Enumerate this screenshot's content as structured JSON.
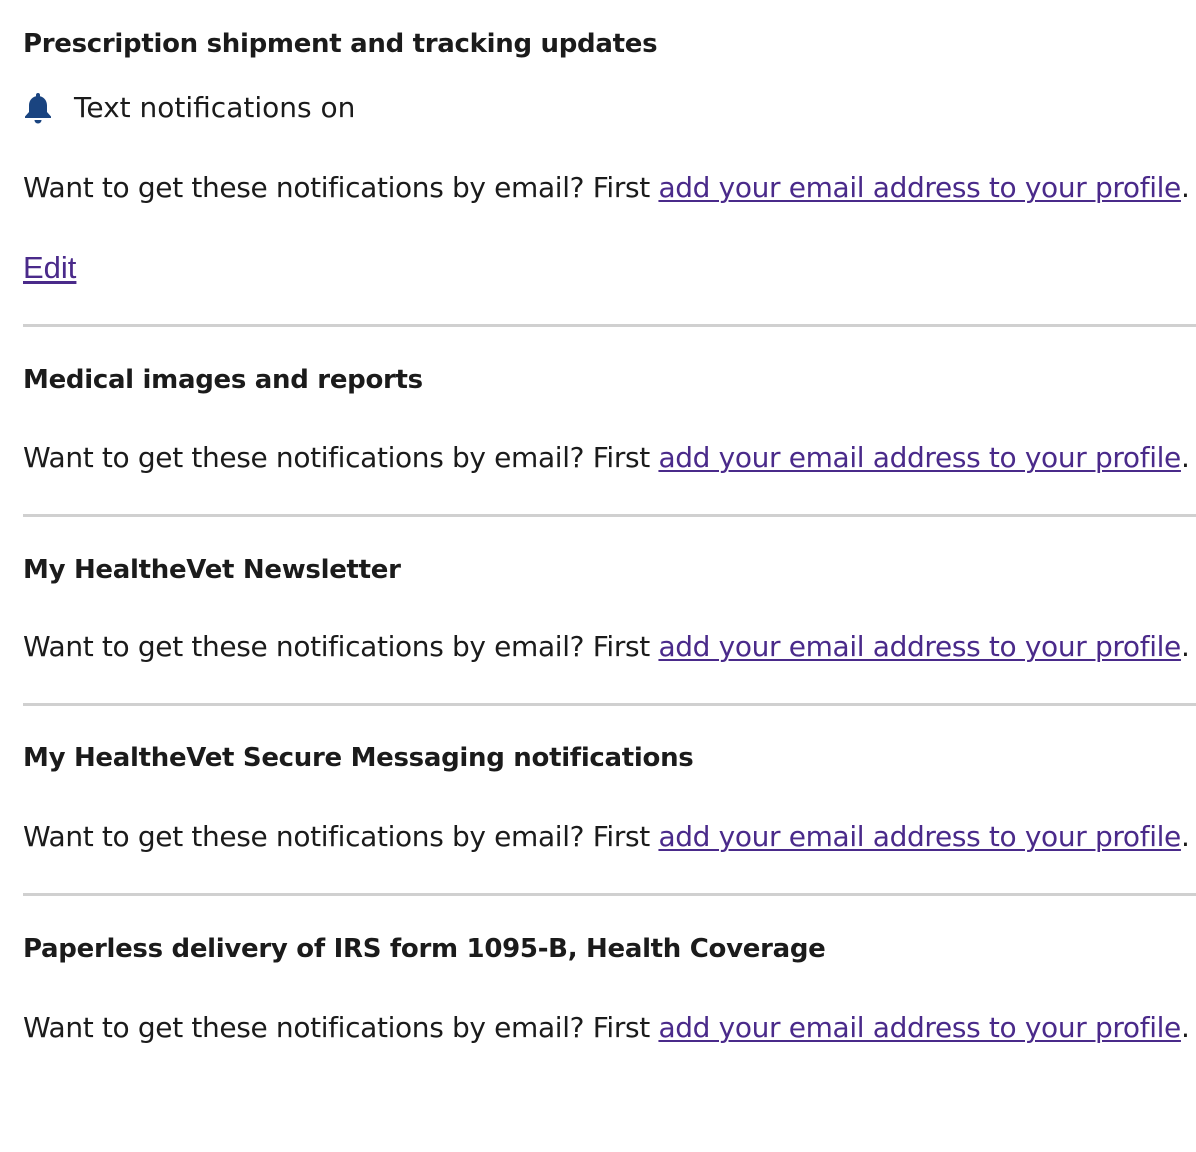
{
  "prompt": {
    "text": "Want to get these notifications by email? First ",
    "link": "add your email address to your profile",
    "suffix": "."
  },
  "sections": [
    {
      "title": "Prescription shipment and tracking updates",
      "status_icon": "bell-icon",
      "status_text": "Text notifications on",
      "edit_label": "Edit"
    },
    {
      "title": "Medical images and reports"
    },
    {
      "title": "My HealtheVet Newsletter"
    },
    {
      "title": "My HealtheVet Secure Messaging notifications"
    },
    {
      "title": "Paperless delivery of IRS form 1095-B, Health Coverage"
    }
  ],
  "colors": {
    "link": "#4a2a8a",
    "bell": "#1a4480",
    "divider": "#d0d0d0"
  }
}
